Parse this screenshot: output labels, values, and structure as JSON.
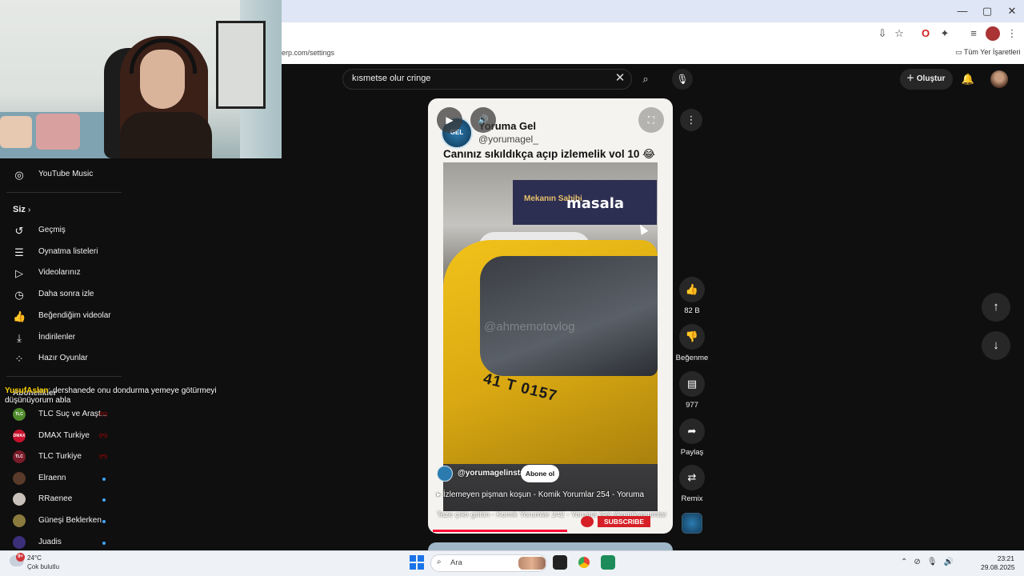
{
  "browser": {
    "url_fragment": "erp.com/settings",
    "bookmarks_all": "Tüm Yer İşaretleri",
    "window_controls": [
      "—",
      "▢",
      "✕"
    ]
  },
  "youtube_header": {
    "search_query": "kısmetse olur cringe",
    "create_label": "Oluştur"
  },
  "sidebar": {
    "music_label": "YouTube Music",
    "you_section": "Siz",
    "you_items": [
      {
        "label": "Geçmiş",
        "icon": "history-icon"
      },
      {
        "label": "Oynatma listeleri",
        "icon": "playlists-icon"
      },
      {
        "label": "Videolarınız",
        "icon": "your-videos-icon"
      },
      {
        "label": "Daha sonra izle",
        "icon": "watch-later-icon"
      },
      {
        "label": "Beğendiğim videolar",
        "icon": "liked-videos-icon"
      },
      {
        "label": "İndirilenler",
        "icon": "downloads-icon"
      },
      {
        "label": "Hazır Oyunlar",
        "icon": "playables-icon"
      }
    ],
    "subscriptions_header": "Abonelikler",
    "subscriptions": [
      {
        "name": "TLC Suç ve Araşt...",
        "avatar_text": "TLC",
        "avatar_color": "#4f8a2b",
        "status": "live"
      },
      {
        "name": "DMAX Turkiye",
        "avatar_text": "DMAX",
        "avatar_color": "#c8102e",
        "status": "live"
      },
      {
        "name": "TLC Turkiye",
        "avatar_text": "TLC",
        "avatar_color": "#7a1c2a",
        "status": "live"
      },
      {
        "name": "Elraenn",
        "avatar_text": "",
        "avatar_color": "#5a3a2a",
        "status": "new"
      },
      {
        "name": "RRaenee",
        "avatar_text": "",
        "avatar_color": "#c9c2bc",
        "status": "new"
      },
      {
        "name": "Güneşi Beklerken",
        "avatar_text": "",
        "avatar_color": "#8a7a3e",
        "status": "new"
      },
      {
        "name": "Juadis",
        "avatar_text": "",
        "avatar_color": "#3b2f7a",
        "status": "new"
      }
    ]
  },
  "chat_overlay": {
    "user": "YusufAslan",
    "message": "dershanede onu dondurma yemeye götürmeyi düşünüyorum abla"
  },
  "short": {
    "channel_name": "Yoruma Gel",
    "channel_handle": "@yorumagel_",
    "title": "Canınız sıkıldıkça açıp izlemelik vol 10 😂",
    "billboard_small": "Mekanın Sahibi",
    "billboard_brand": "masala",
    "plate": "41 T 0157",
    "watermark": "@ahmemotovlog",
    "overlay_handle": "@yorumagelinsta",
    "subscribe_label": "Abone ol",
    "playlist_line": "İzlemeyen pişman koşun - Komik Yorumlar 254 - Yoruma",
    "bottom_caption": "Taze çıktı gülün - Komik Yorumlar 242 - Yoruma Gel #komikyorumlar",
    "in_video_subscribe": "SUBSCRIBE",
    "progress": 0.56
  },
  "actions": {
    "likes": "82 B",
    "dislike_label": "Beğenme",
    "comments": "977",
    "share_label": "Paylaş",
    "remix_label": "Remix"
  },
  "taskbar": {
    "weather_badge": "9+",
    "temperature": "24°C",
    "weather_desc": "Çok bulutlu",
    "search_placeholder": "Ara",
    "time": "23:21",
    "date": "29.08.2025"
  }
}
